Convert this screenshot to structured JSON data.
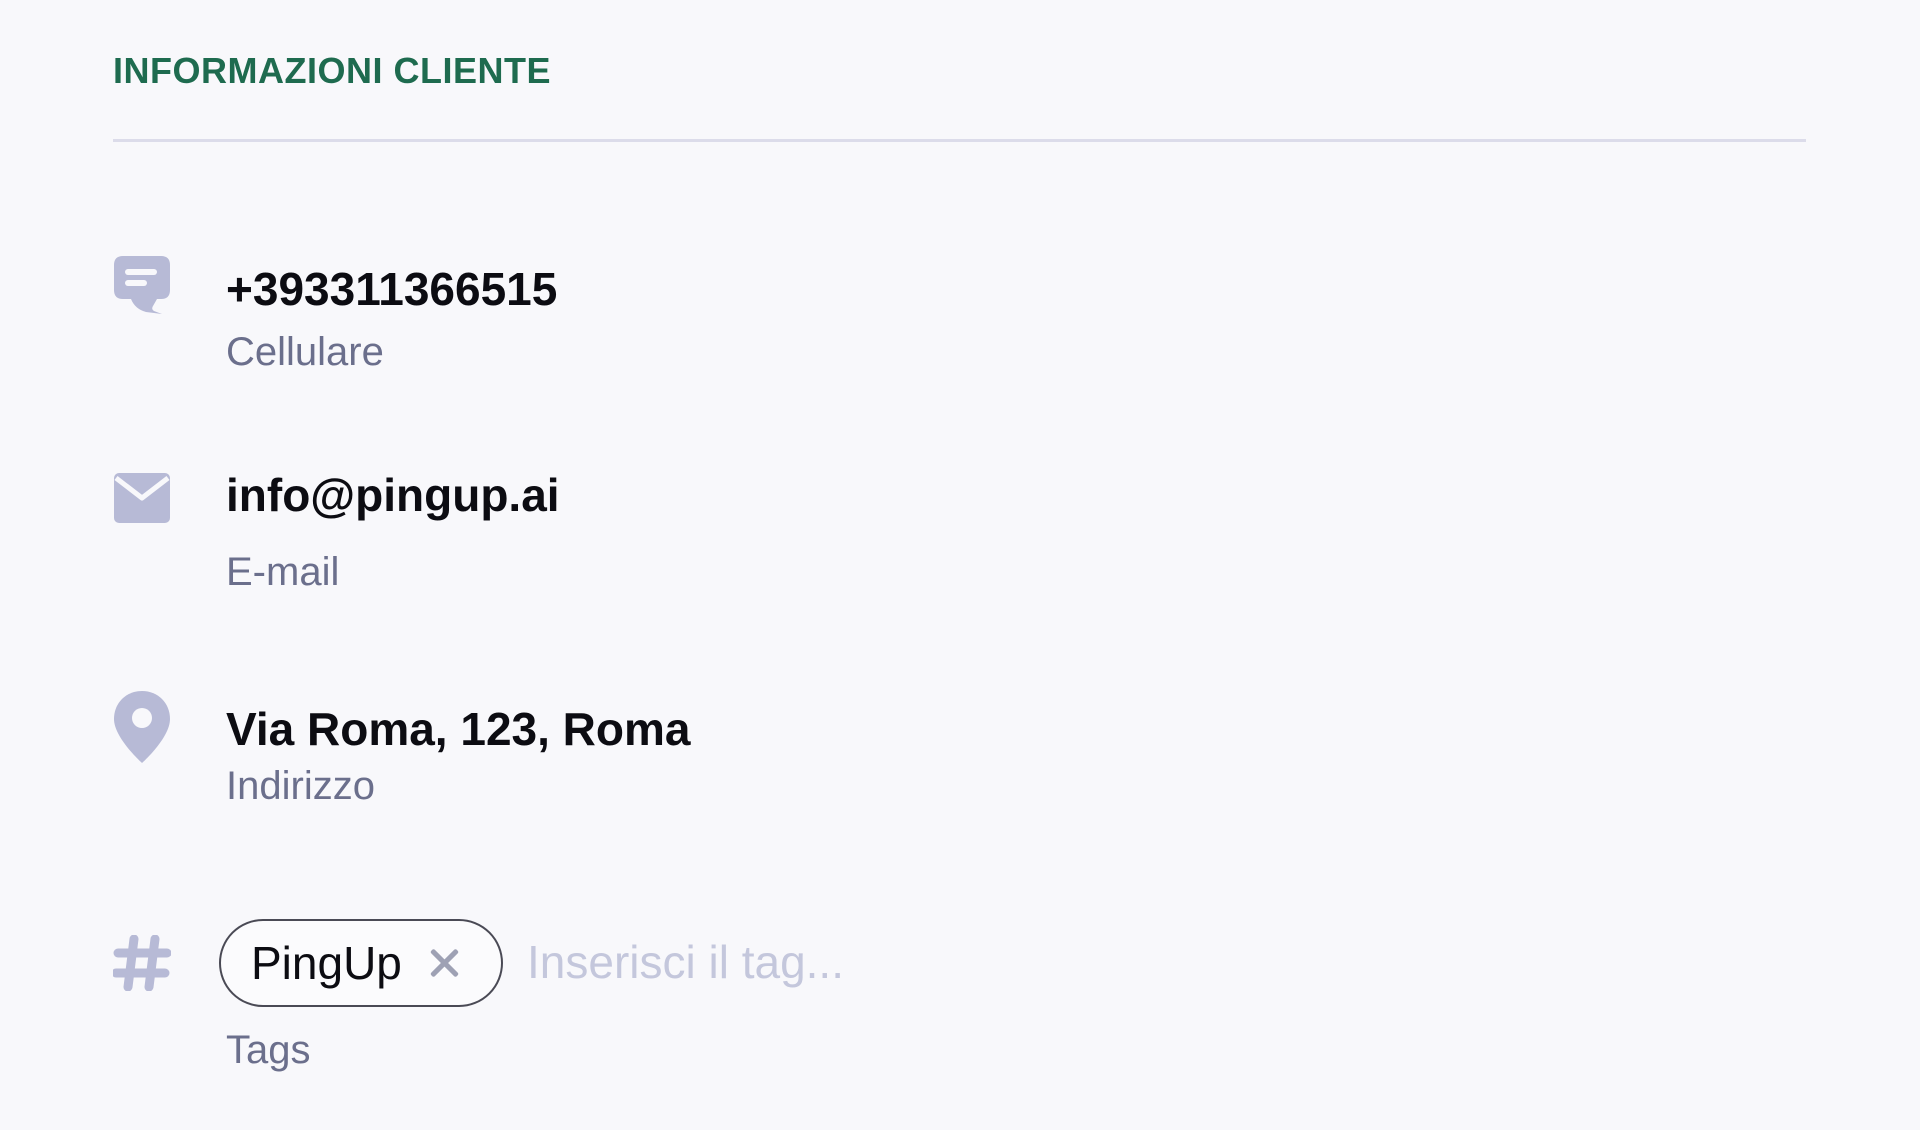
{
  "section": {
    "title": "INFORMAZIONI CLIENTE"
  },
  "contact": {
    "phone": {
      "value": "+393311366515",
      "label": "Cellulare",
      "icon": "chat-icon"
    },
    "email": {
      "value": "info@pingup.ai",
      "label": "E-mail",
      "icon": "mail-icon"
    },
    "address": {
      "value": "Via Roma, 123, Roma",
      "label": "Indirizzo",
      "icon": "location-pin-icon"
    }
  },
  "tags": {
    "icon": "hashtag-icon",
    "items": [
      {
        "label": "PingUp"
      }
    ],
    "input_placeholder": "Inserisci il tag...",
    "label": "Tags"
  },
  "colors": {
    "accent": "#1e6b4f",
    "icon": "#b7bad6",
    "caption": "#6b6f8c",
    "background": "#f8f8fb"
  }
}
